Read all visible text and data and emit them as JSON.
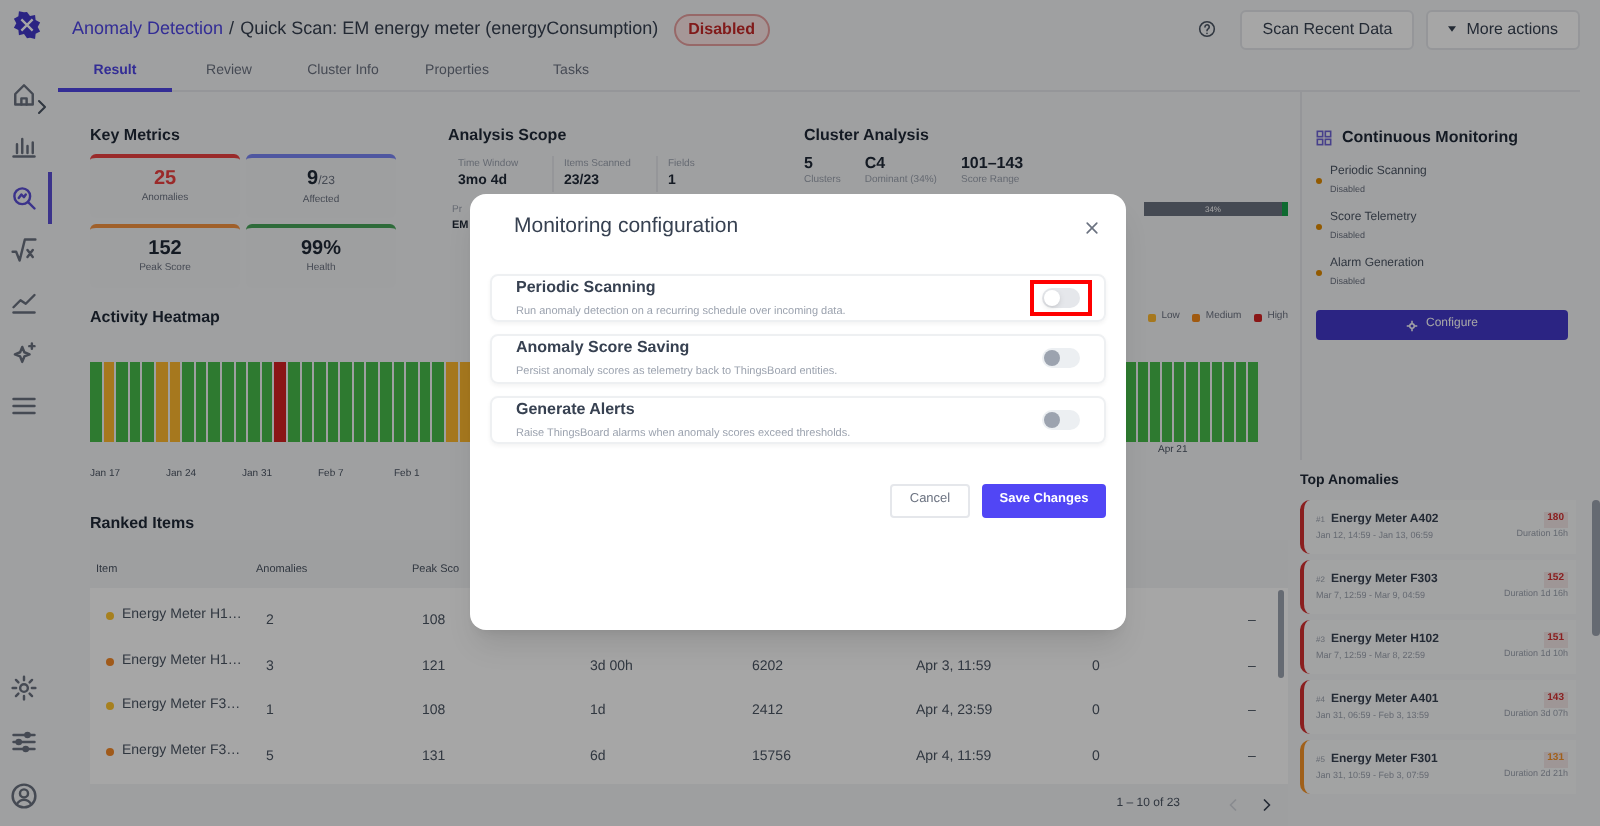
{
  "sidebar": {
    "top_items": [
      {
        "kind": "home",
        "selected": false
      },
      {
        "kind": "chart",
        "selected": false
      },
      {
        "kind": "search",
        "selected": true
      },
      {
        "kind": "function",
        "selected": false
      },
      {
        "kind": "trend",
        "selected": false
      },
      {
        "kind": "sparkle",
        "selected": false
      },
      {
        "kind": "menu",
        "selected": false
      }
    ],
    "bottom_items": [
      {
        "kind": "gear",
        "selected": false
      },
      {
        "kind": "sliders",
        "selected": false
      },
      {
        "kind": "user",
        "selected": false
      }
    ]
  },
  "header": {
    "breadcrumb_link": "Anomaly Detection",
    "separator": "/",
    "title": "Quick Scan: EM energy meter (energyConsumption)",
    "status": "Disabled",
    "buttons": [
      "Scan Recent Data",
      "More actions"
    ]
  },
  "tabs": [
    {
      "label": "Result",
      "selected": true
    },
    {
      "label": "Review",
      "selected": false
    },
    {
      "label": "Cluster Info",
      "selected": false
    },
    {
      "label": "Properties",
      "selected": false
    },
    {
      "label": "Tasks",
      "selected": false
    }
  ],
  "key_metrics": {
    "title": "Key Metrics",
    "cards": [
      {
        "value": "25",
        "label": "Anomalies",
        "color": "#9a2a2a"
      },
      {
        "value": "9",
        "suffix": "/23",
        "label": "Affected",
        "color": "#4f57a0"
      },
      {
        "value": "152",
        "label": "Peak Score",
        "color": "#a0602a"
      },
      {
        "value": "99%",
        "label": "Health",
        "color": "#2e6b3a"
      }
    ]
  },
  "analysis_scope": {
    "title": "Analysis Scope",
    "fields": [
      {
        "label": "Time Window",
        "value": "3mo 4d"
      },
      {
        "label": "Items Scanned",
        "value": "23/23"
      },
      {
        "label": "Fields",
        "value": "1"
      },
      {
        "label": "Pr",
        "value": "EM"
      }
    ]
  },
  "cluster_analysis": {
    "title": "Cluster Analysis",
    "stats": [
      {
        "value": "5",
        "label": "Clusters"
      },
      {
        "value": "C4",
        "label": "Dominant (34%)"
      },
      {
        "value": "101–143",
        "label": "Score Range"
      }
    ],
    "bar_label": "34%"
  },
  "activity_heatmap": {
    "title": "Activity Heatmap",
    "legend": [
      {
        "label": "Low",
        "color": "#a6781e"
      },
      {
        "label": "Medium",
        "color": "#a05a10"
      },
      {
        "label": "High",
        "color": "#8a1717"
      }
    ],
    "cells_left": [
      {
        "color": "#2e7a30"
      },
      {
        "color": "#a6781e"
      },
      {
        "color": "#2e7a30"
      },
      {
        "color": "#2e7a30"
      },
      {
        "color": "#2e7a30"
      },
      {
        "color": "#a6781e"
      },
      {
        "color": "#a6781e"
      },
      {
        "color": "#2e7a30"
      },
      {
        "color": "#2e7a30"
      },
      {
        "color": "#2e7a30"
      },
      {
        "color": "#2e7a30"
      },
      {
        "color": "#2e7a30"
      },
      {
        "color": "#2e7a30"
      },
      {
        "color": "#2e7a30"
      },
      {
        "color": "#8a1717"
      },
      {
        "color": "#2e7a30"
      },
      {
        "color": "#2e7a30"
      },
      {
        "color": "#2e7a30"
      },
      {
        "color": "#2e7a30"
      },
      {
        "color": "#2e7a30"
      },
      {
        "color": "#2e7a30"
      },
      {
        "color": "#2e7a30"
      },
      {
        "color": "#2e7a30"
      },
      {
        "color": "#2e7a30"
      },
      {
        "color": "#2e7a30"
      },
      {
        "color": "#2e7a30"
      },
      {
        "color": "#2e7a30"
      },
      {
        "color": "#a6781e"
      },
      {
        "color": "#a6781e"
      }
    ],
    "cells_right": [
      {
        "color": "#2e7a30"
      },
      {
        "color": "#2e7a30"
      },
      {
        "color": "#2e7a30"
      },
      {
        "color": "#2e7a30"
      },
      {
        "color": "#2e7a30"
      },
      {
        "color": "#2e7a30"
      },
      {
        "color": "#2e7a30"
      },
      {
        "color": "#2e7a30"
      },
      {
        "color": "#2e7a30"
      },
      {
        "color": "#2e7a30"
      },
      {
        "color": "#2e7a30"
      }
    ],
    "axis_labels_left": [
      "Jan 17",
      "Jan 24",
      "Jan 31",
      "Feb 7",
      "Feb 1"
    ],
    "axis_label_right": "Apr 21"
  },
  "ranked_items": {
    "title": "Ranked Items",
    "columns": [
      "Item",
      "Anomalies",
      "Peak Sco"
    ],
    "rows": [
      {
        "color": "#a6801e",
        "item": "Energy Meter H1…",
        "anomalies": "2",
        "peak_score": "108",
        "column_8": "–"
      },
      {
        "color": "#a05a1a",
        "item": "Energy Meter H1…",
        "anomalies": "3",
        "peak_score": "121",
        "column_4": "3d 00h",
        "column_5": "6202",
        "column_6": "Apr 3, 11:59",
        "column_7": "0",
        "column_8": "–"
      },
      {
        "color": "#a6801e",
        "item": "Energy Meter F3…",
        "anomalies": "1",
        "peak_score": "108",
        "column_4": "1d",
        "column_5": "2412",
        "column_6": "Apr 4, 23:59",
        "column_7": "0",
        "column_8": "–"
      },
      {
        "color": "#a05a1a",
        "item": "Energy Meter F3…",
        "anomalies": "5",
        "peak_score": "131",
        "column_4": "6d",
        "column_5": "15756",
        "column_6": "Apr 4, 11:59",
        "column_7": "0",
        "column_8": "–"
      }
    ],
    "pagination": {
      "range": "1 – 10 of 23",
      "prev_disabled": true,
      "next_disabled": false
    }
  },
  "monitoring_panel": {
    "title": "Continuous Monitoring",
    "items": [
      {
        "label": "Periodic Scanning",
        "status": "Disabled"
      },
      {
        "label": "Score Telemetry",
        "status": "Disabled"
      },
      {
        "label": "Alarm Generation",
        "status": "Disabled"
      }
    ],
    "button": "Configure"
  },
  "top_anomalies": {
    "title": "Top Anomalies",
    "items": [
      {
        "rank": "#1",
        "name": "Energy Meter A402",
        "range": "Jan 12, 14:59 - Jan 13, 06:59",
        "score": "180",
        "duration": "Duration 16h",
        "color": "#8a1f1f"
      },
      {
        "rank": "#2",
        "name": "Energy Meter F303",
        "range": "Mar 7, 12:59 - Mar 9, 04:59",
        "score": "152",
        "duration": "Duration 1d 16h",
        "color": "#8a1f1f"
      },
      {
        "rank": "#3",
        "name": "Energy Meter H102",
        "range": "Mar 7, 12:59 - Mar 8, 22:59",
        "score": "151",
        "duration": "Duration 1d 10h",
        "color": "#8a1f1f"
      },
      {
        "rank": "#4",
        "name": "Energy Meter A401",
        "range": "Jan 31, 06:59 - Feb 3, 13:59",
        "score": "143",
        "duration": "Duration 3d 07h",
        "color": "#8a1f1f"
      },
      {
        "rank": "#5",
        "name": "Energy Meter F301",
        "range": "Jan 31, 10:59 - Feb 3, 07:59",
        "score": "131",
        "duration": "Duration 2d 21h",
        "color": "#a0601a"
      }
    ]
  },
  "modal": {
    "title": "Monitoring configuration",
    "options": [
      {
        "title": "Periodic Scanning",
        "description": "Run anomaly detection on a recurring schedule over incoming data.",
        "on": false,
        "highlighted": true
      },
      {
        "title": "Anomaly Score Saving",
        "description": "Persist anomaly scores as telemetry back to ThingsBoard entities.",
        "on": false,
        "highlighted": false
      },
      {
        "title": "Generate Alerts",
        "description": "Raise ThingsBoard alarms when anomaly scores exceed thresholds.",
        "on": false,
        "highlighted": false
      }
    ],
    "buttons": [
      {
        "label": "Cancel",
        "kind": "secondary"
      },
      {
        "label": "Save Changes",
        "kind": "primary"
      }
    ]
  }
}
